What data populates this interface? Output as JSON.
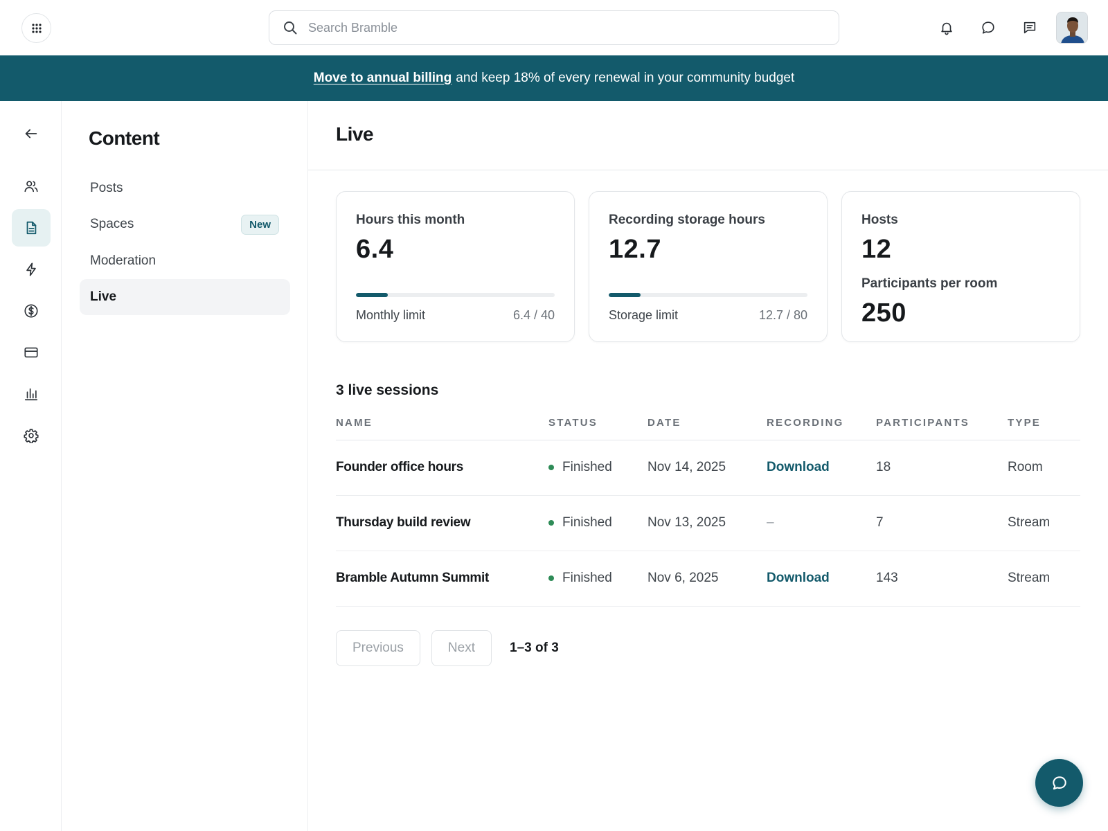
{
  "topbar": {
    "search_placeholder": "Search Bramble",
    "icons": [
      "apps-grid-icon",
      "search-icon",
      "bell-icon",
      "chat-bubble-icon",
      "message-square-icon"
    ]
  },
  "banner": {
    "link_text": "Move to annual billing",
    "text": "and keep 18% of every renewal in your community budget"
  },
  "rail": {
    "icons": [
      "arrow-left-icon",
      "users-icon",
      "document-icon",
      "bolt-icon",
      "dollar-icon",
      "credit-card-icon",
      "bar-chart-icon",
      "settings-icon"
    ],
    "active": "document-icon"
  },
  "subnav": {
    "title": "Content",
    "items": [
      {
        "label": "Posts"
      },
      {
        "label": "Spaces",
        "badge": "New"
      },
      {
        "label": "Moderation"
      },
      {
        "label": "Live",
        "active": true
      }
    ]
  },
  "page": {
    "title": "Live"
  },
  "cards": [
    {
      "label": "Hours this month",
      "value": "6.4",
      "limit_label": "Monthly limit",
      "limit_text": "6.4 / 40",
      "fraction": 0.16
    },
    {
      "label": "Recording storage hours",
      "value": "12.7",
      "limit_label": "Storage limit",
      "limit_text": "12.7 / 80",
      "fraction": 0.16
    },
    {
      "label": "Hosts",
      "value": "12",
      "label2": "Participants per room",
      "value2": "250"
    }
  ],
  "sessions": {
    "title": "3 live sessions",
    "columns": [
      "NAME",
      "STATUS",
      "DATE",
      "RECORDING",
      "PARTICIPANTS",
      "TYPE"
    ],
    "rows": [
      {
        "name": "Founder office hours",
        "status": "Finished",
        "date": "Nov 14, 2025",
        "recording": "Download",
        "participants": "18",
        "type": "Room"
      },
      {
        "name": "Thursday build review",
        "status": "Finished",
        "date": "Nov 13, 2025",
        "recording": "–",
        "participants": "7",
        "type": "Stream"
      },
      {
        "name": "Bramble Autumn Summit",
        "status": "Finished",
        "date": "Nov 6, 2025",
        "recording": "Download",
        "participants": "143",
        "type": "Stream"
      }
    ]
  },
  "pagination": {
    "previous": "Previous",
    "next": "Next",
    "info": "1–3 of 3"
  },
  "colors": {
    "brand": "#135a6b",
    "status_finished": "#2e8b57"
  }
}
